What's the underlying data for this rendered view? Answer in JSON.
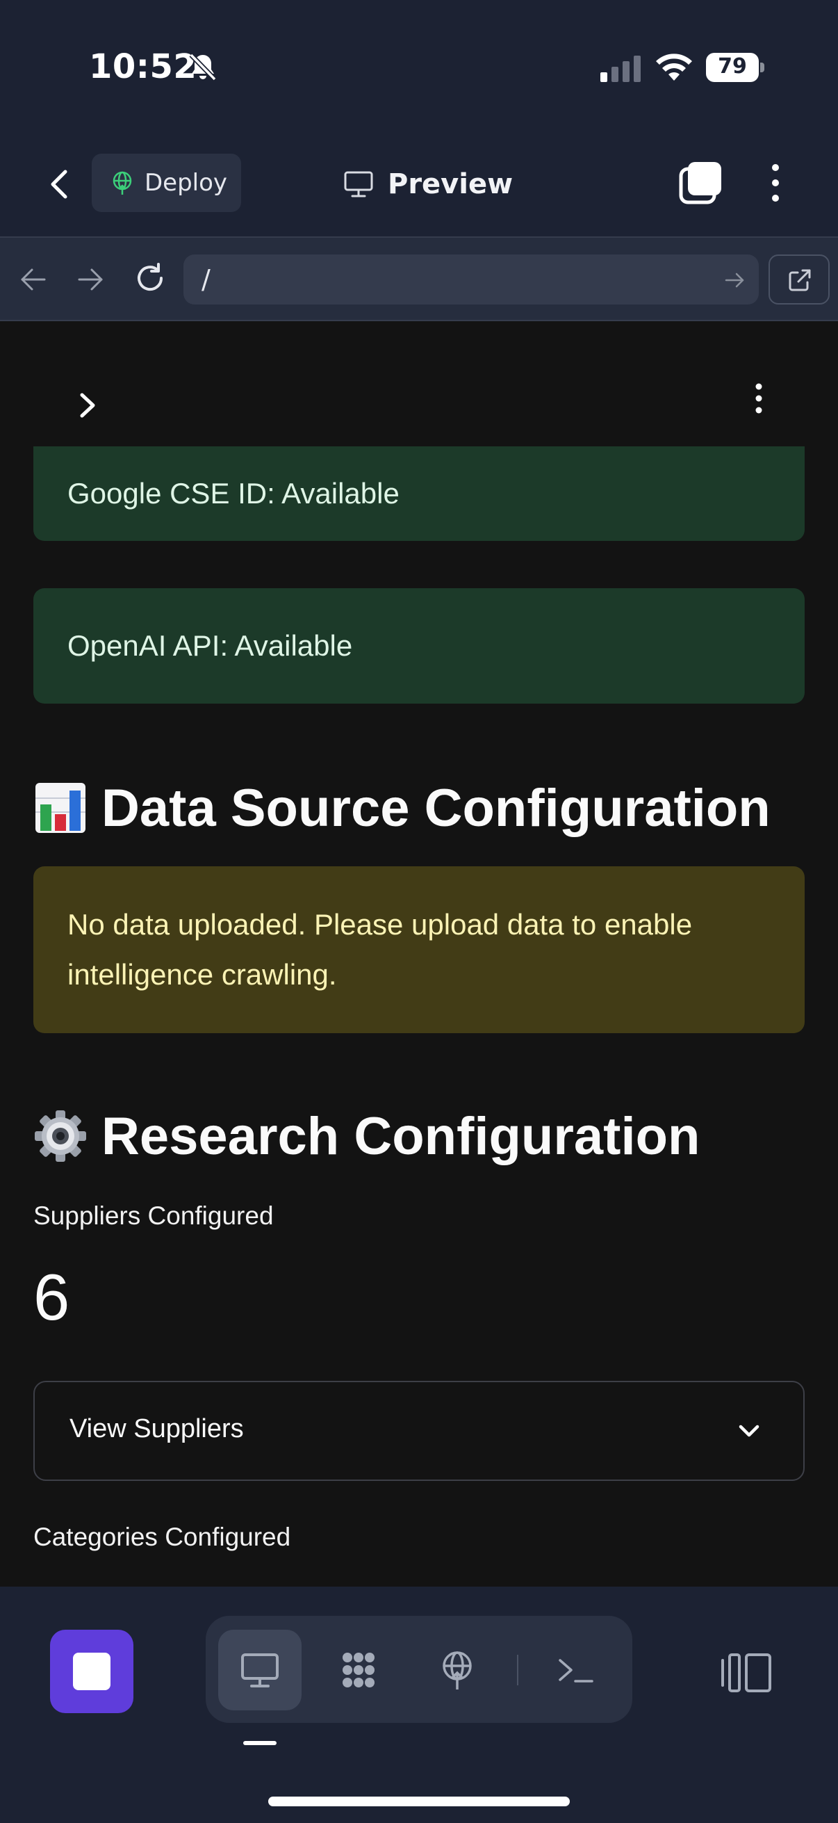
{
  "status_bar": {
    "time": "10:52",
    "battery": "79"
  },
  "header": {
    "deploy_label": "Deploy",
    "title": "Preview"
  },
  "browser": {
    "url": "/"
  },
  "alerts": {
    "cse": "Google CSE ID: Available",
    "openai": "OpenAI API: Available",
    "no_data": "No data uploaded. Please upload data to enable intelligence crawling."
  },
  "sections": {
    "data_source": "Data Source Configuration",
    "research": "Research Configuration"
  },
  "metrics": {
    "suppliers_label": "Suppliers Configured",
    "suppliers_value": "6",
    "categories_label": "Categories Configured"
  },
  "expander": {
    "view_suppliers": "View Suppliers"
  },
  "icons": {
    "data_source_emoji": "bar-chart-icon",
    "research_emoji": "gear-icon"
  },
  "colors": {
    "success_bg": "#1c3a29",
    "warning_bg": "#423c16",
    "accent": "#5f3ddb"
  }
}
